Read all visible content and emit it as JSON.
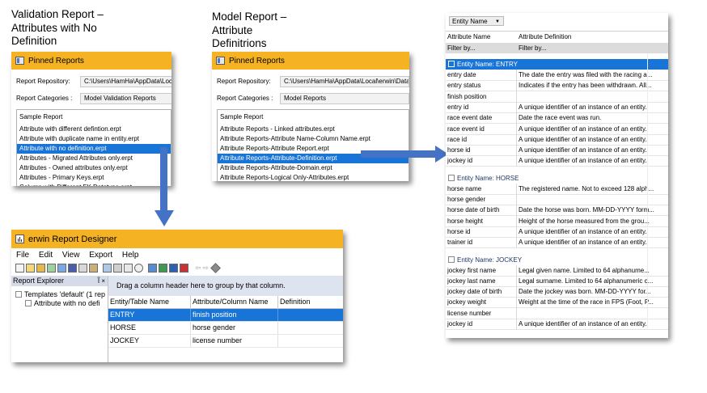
{
  "captions": {
    "validation_lines": [
      "Validation Report –",
      "Attributes with No",
      "Definition"
    ],
    "model_lines": [
      "Model Report –",
      "Attribute",
      "Definitrions"
    ]
  },
  "validation_panel": {
    "title": "Pinned Reports",
    "repository_label": "Report Repository:",
    "repository_value": "C:\\Users\\HamHa\\AppData\\Local",
    "categories_label": "Report Categories :",
    "categories_value": "Model Validation Reports",
    "items": [
      "Sample Report",
      "Attribute with different defintion.erpt",
      "Attribute with duplicate name in entity.erpt",
      "Attribute with no definition.erpt",
      "Attributes - Migrated Attributes only.erpt",
      "Attributes - Owned attributes only.erpt",
      "Attributes - Primary Keys.erpt",
      "Column with Different FK Datatype.erpt"
    ],
    "selected_index": 3
  },
  "model_panel": {
    "title": "Pinned Reports",
    "repository_label": "Report Repository:",
    "repository_value": "C:\\Users\\HamHa\\AppData\\Local\\erwin\\Data M",
    "categories_label": "Report Categories :",
    "categories_value": "Model Reports",
    "items": [
      "Sample Report",
      "Attribute Reports - Linked attributes.erpt",
      "Attribute Reports-Attribute Name-Column Name.erpt",
      "Attribute Reports-Attribute Report.erpt",
      "Attribute Reports-Attribute-Definition.erpt",
      "Attribute Reports-Attribute-Domain.erpt",
      "Attribute Reports-Logical Only-Attributes.erpt"
    ],
    "selected_index": 4
  },
  "designer": {
    "title": "erwin Report Designer",
    "menu": [
      "File",
      "Edit",
      "View",
      "Export",
      "Help"
    ],
    "explorer_title": "Report Explorer",
    "explorer_pin": "Ĩ ×",
    "tree_root": "Templates 'default' (1 rep",
    "tree_child": "Attribute with no defi",
    "group_hint": "Drag a column header here to group by that column.",
    "columns": [
      "Entity/Table Name",
      "Attribute/Column Name",
      "Definition"
    ],
    "rows": [
      [
        "ENTRY",
        "finish position",
        ""
      ],
      [
        "HORSE",
        "horse gender",
        ""
      ],
      [
        "JOCKEY",
        "license number",
        ""
      ]
    ],
    "selected_row": 0
  },
  "grid": {
    "groupby_chip": "Entity Name",
    "headers": [
      "Attribute Name",
      "Attribute Definition"
    ],
    "filter_placeholder": [
      "Filter by...",
      "Filter by..."
    ],
    "groups": [
      {
        "label": "Entity Name: ENTRY",
        "active": true,
        "rows": [
          [
            "entry date",
            "The date the entry was filed with the racing a..."
          ],
          [
            "entry status",
            "Indicates if the entry has been withdrawn. All..."
          ],
          [
            "finish position",
            ""
          ],
          [
            "entry id",
            "A unique identifier of an instance of an entity."
          ],
          [
            "race event date",
            "Date the race event was run."
          ],
          [
            "race event id",
            "A unique identifier of an instance of an entity."
          ],
          [
            "race id",
            "A unique identifier of an instance of an entity."
          ],
          [
            "horse id",
            "A unique identifier of an instance of an entity."
          ],
          [
            "jockey id",
            "A unique identifier of an instance of an entity."
          ]
        ]
      },
      {
        "label": "Entity Name: HORSE",
        "active": false,
        "rows": [
          [
            "horse name",
            "The registered name. Not to exceed 128 alph..."
          ],
          [
            "horse gender",
            ""
          ],
          [
            "horse date of birth",
            "Date the horse was born. MM-DD-YYYY form..."
          ],
          [
            "horse height",
            "Height of the horse measured from the grou..."
          ],
          [
            "horse id",
            "A unique identifier of an instance of an entity."
          ],
          [
            "trainer id",
            "A unique identifier of an instance of an entity."
          ]
        ]
      },
      {
        "label": "Entity Name: JOCKEY",
        "active": false,
        "rows": [
          [
            "jockey first name",
            "Legal given name.  Limited to 64 alphanume..."
          ],
          [
            "jockey last name",
            "Legal surname. Limited to 64 alphanumeric c..."
          ],
          [
            "jockey date of birth",
            "Date the jockey was born. MM-DD-YYYY for..."
          ],
          [
            "jockey weight",
            "Weight at the time of the race in FPS (Foot, P..."
          ],
          [
            "license number",
            ""
          ],
          [
            "jockey id",
            "A unique identifier of an instance of an entity."
          ]
        ]
      }
    ]
  },
  "colors": {
    "orange": "#f5b323",
    "selection_blue": "#1874d6",
    "arrow_blue": "#4472c4"
  }
}
